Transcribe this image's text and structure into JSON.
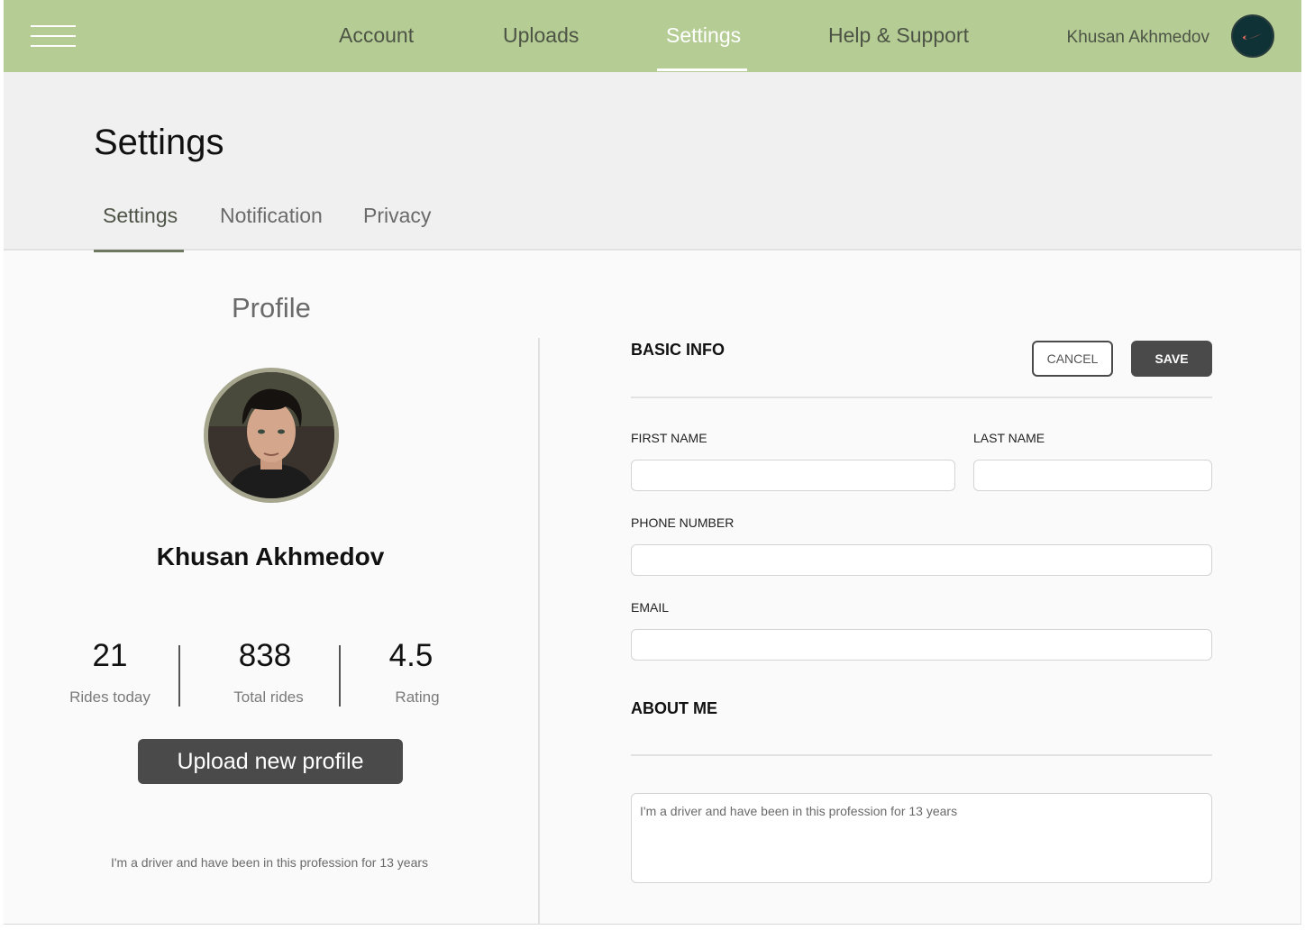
{
  "topbar": {
    "nav": [
      {
        "label": "Account"
      },
      {
        "label": "Uploads"
      },
      {
        "label": "Settings"
      },
      {
        "label": "Help & Support"
      }
    ],
    "active_nav": "Settings",
    "user_name": "Khusan Akhmedov",
    "logo_icon": "swoosh-logo-icon",
    "background_color": "#b5cd94"
  },
  "header": {
    "title": "Settings",
    "tabs": [
      {
        "label": "Settings"
      },
      {
        "label": "Notification"
      },
      {
        "label": "Privacy"
      }
    ],
    "active_tab": "Settings"
  },
  "profile": {
    "heading": "Profile",
    "name": "Khusan Akhmedov",
    "stats": [
      {
        "value": "21",
        "label": "Rides today"
      },
      {
        "value": "838",
        "label": "Total rides"
      },
      {
        "value": "4.5",
        "label": "Rating"
      }
    ],
    "upload_label": "Upload new profile",
    "bio": "I'm a driver and have been in this profession for 13 years"
  },
  "basic_info": {
    "title": "BASIC INFO",
    "cancel_label": "CANCEL",
    "save_label": "SAVE",
    "first_name_label": "FIRST NAME",
    "first_name_value": "",
    "last_name_label": "LAST NAME",
    "last_name_value": "",
    "phone_label": "PHONE NUMBER",
    "phone_value": "",
    "email_label": "EMAIL",
    "email_value": ""
  },
  "about": {
    "title": "ABOUT ME",
    "placeholder": "I'm a driver and have been in this profession for 13 years"
  }
}
